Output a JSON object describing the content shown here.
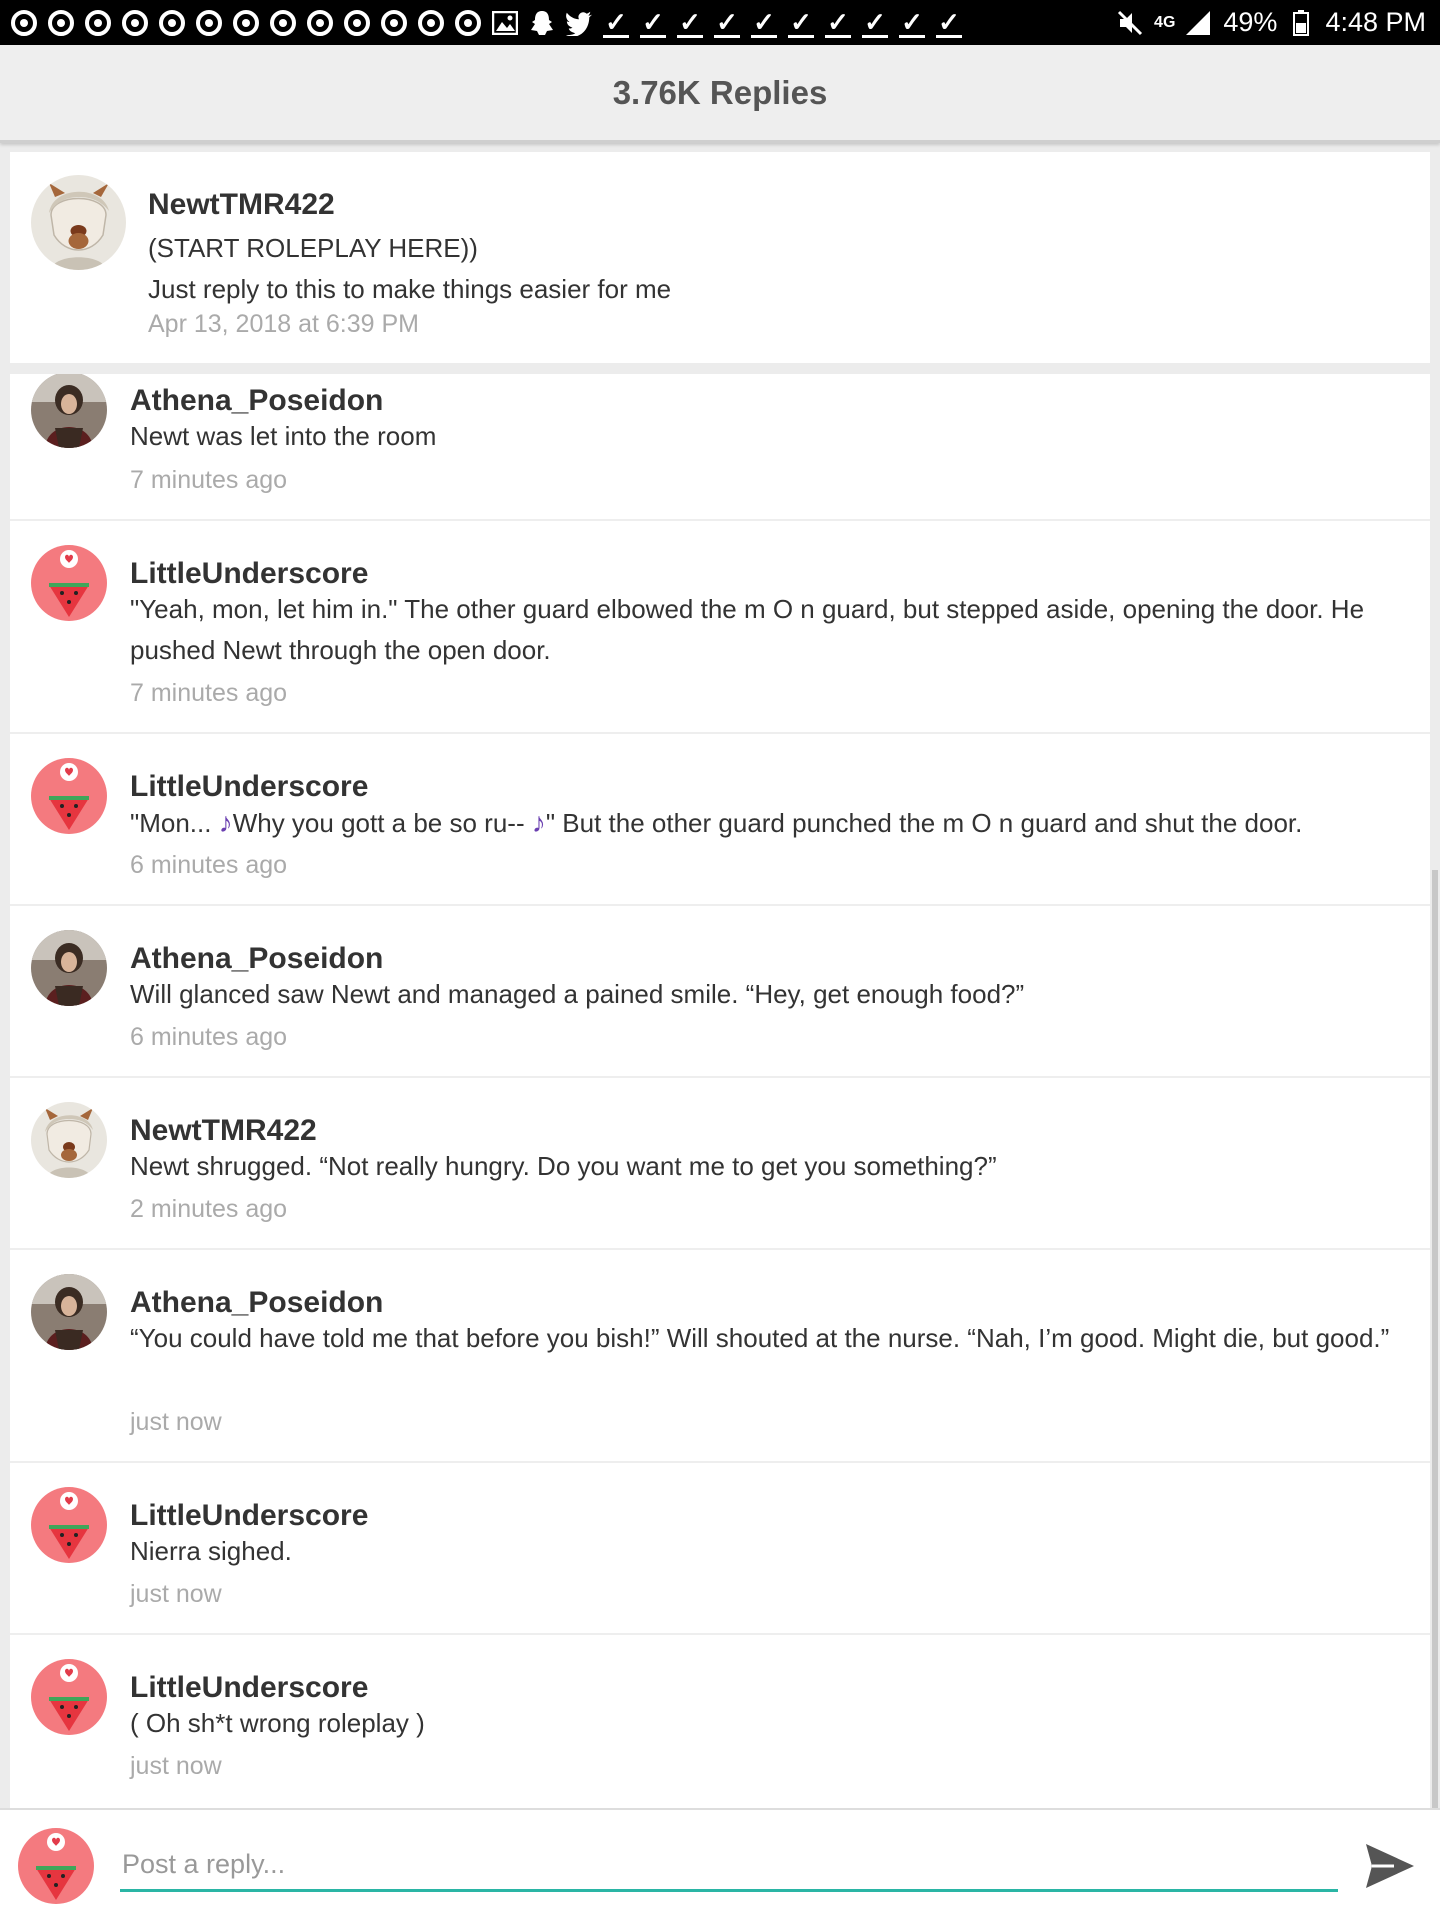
{
  "status_bar": {
    "network": "4G",
    "battery": "49%",
    "time": "4:48 PM"
  },
  "header": {
    "title": "3.76K Replies"
  },
  "original_post": {
    "author": "NewtTMR422",
    "lines": [
      "(START ROLEPLAY HERE))",
      "Just reply to this to make things easier for me"
    ],
    "timestamp": "Apr 13, 2018 at 6:39 PM",
    "avatar": "newt-avatar"
  },
  "replies": [
    {
      "author": "Athena_Poseidon",
      "avatar": "athena-avatar",
      "text": "Newt was let into the room",
      "time": "7 minutes ago"
    },
    {
      "author": "LittleUnderscore",
      "avatar": "watermelon-avatar",
      "text": "\"Yeah, mon, let him in.\" The other guard elbowed the  m O n  guard, but stepped aside, opening the door. He pushed Newt through the open door.",
      "time": "7 minutes ago"
    },
    {
      "author": "LittleUnderscore",
      "avatar": "watermelon-avatar",
      "text_a": "\"Mon... ",
      "note": "♪",
      "text_b": "Why you gott a be so ru-- ",
      "text_c": "\" But the other guard punched the  m O n  guard and shut the door.",
      "time": "6 minutes ago"
    },
    {
      "author": "Athena_Poseidon",
      "avatar": "athena-avatar",
      "text": "Will glanced saw Newt and managed a pained smile. “Hey, get enough food?”",
      "time": "6 minutes ago"
    },
    {
      "author": "NewtTMR422",
      "avatar": "newt-avatar",
      "text": "Newt shrugged. “Not really hungry. Do you want me to get you something?”",
      "time": "2 minutes ago"
    },
    {
      "author": "Athena_Poseidon",
      "avatar": "athena-avatar",
      "text": "“You could have told me that before you bish!” Will shouted at the nurse. “Nah, I’m good. Might die, but good.”",
      "time": "just now"
    },
    {
      "author": "LittleUnderscore",
      "avatar": "watermelon-avatar",
      "text": "Nierra sighed.",
      "time": "just now"
    },
    {
      "author": "LittleUnderscore",
      "avatar": "watermelon-avatar",
      "text": "( Oh sh*t wrong roleplay )",
      "time": "just now"
    }
  ],
  "composer": {
    "placeholder": "Post a reply...",
    "send_icon": "send-icon",
    "avatar": "watermelon-avatar"
  },
  "colors": {
    "accent": "#2ab5a5",
    "timestamp": "#aaaaaa",
    "header_text": "#555555",
    "watermelon": "#f47a7f"
  }
}
